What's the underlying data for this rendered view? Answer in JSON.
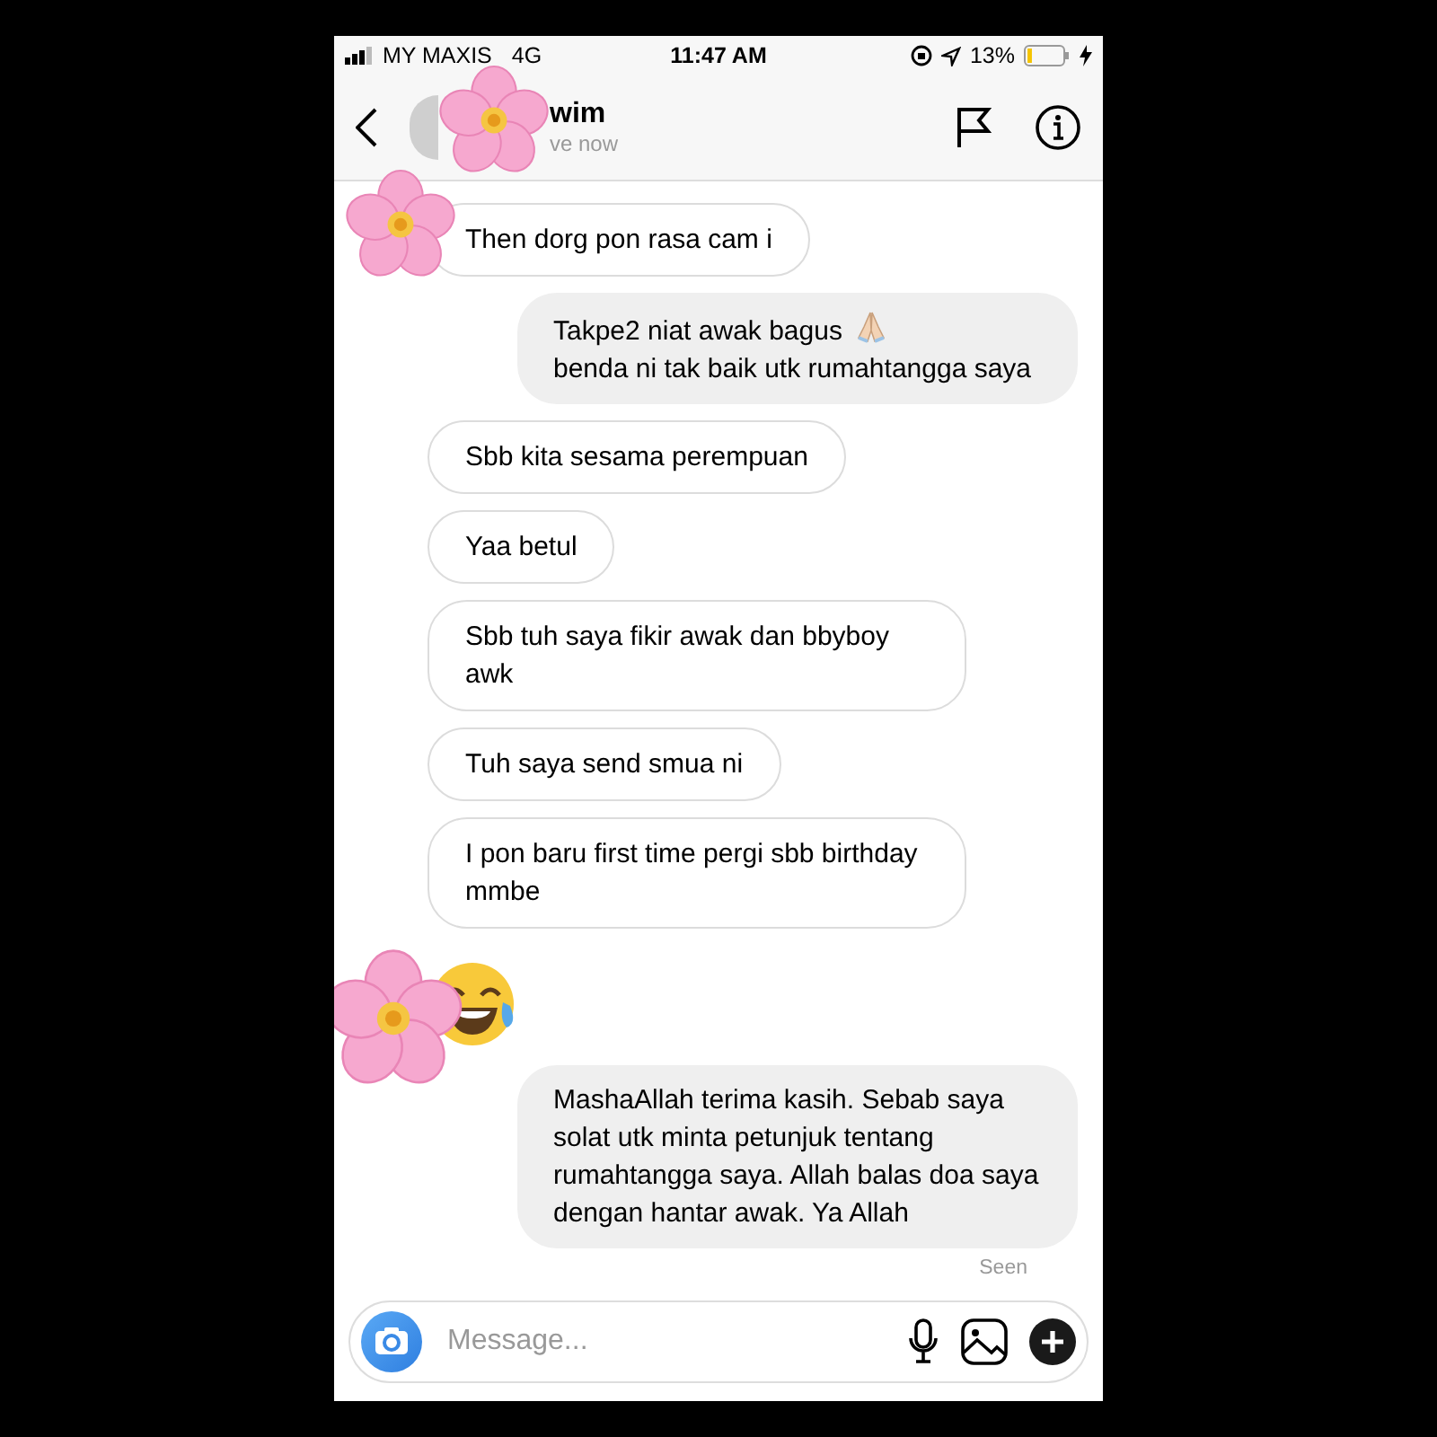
{
  "status_bar": {
    "carrier": "MY MAXIS",
    "network": "4G",
    "time": "11:47 AM",
    "battery": "13%"
  },
  "header": {
    "name": "wim",
    "status": "ve now"
  },
  "messages": [
    {
      "kind": "text",
      "outgoing": false,
      "text": "Then dorg pon rasa cam i"
    },
    {
      "kind": "emoji_text",
      "outgoing": true,
      "text": "Takpe2 niat awak bagus",
      "text_after": "benda ni tak baik utk rumahtangga saya"
    },
    {
      "kind": "text",
      "outgoing": false,
      "text": "Sbb kita sesama perempuan"
    },
    {
      "kind": "text",
      "outgoing": false,
      "text": "Yaa betul"
    },
    {
      "kind": "text",
      "outgoing": false,
      "text": "Sbb tuh saya fikir awak dan bbyboy awk"
    },
    {
      "kind": "text",
      "outgoing": false,
      "text": "Tuh saya send smua ni"
    },
    {
      "kind": "text",
      "outgoing": false,
      "text": "I pon baru first time pergi sbb birthday mmbe"
    },
    {
      "kind": "emoji",
      "outgoing": false
    },
    {
      "kind": "text",
      "outgoing": true,
      "text": "MashaAllah terima kasih. Sebab saya solat utk minta petunjuk tentang rumahtangga saya. Allah balas doa saya dengan hantar awak. Ya Allah"
    }
  ],
  "seen": "Seen",
  "composer": {
    "placeholder": "Message..."
  }
}
